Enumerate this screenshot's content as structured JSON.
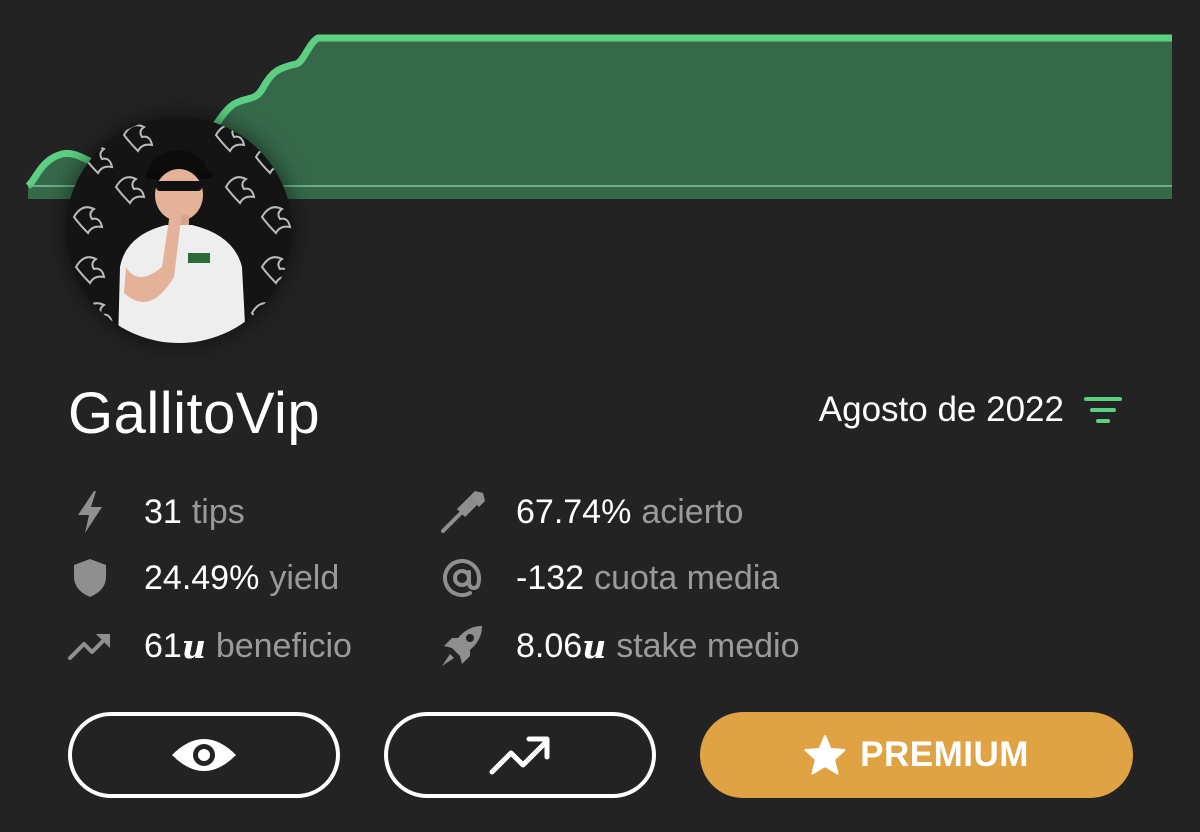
{
  "profile": {
    "username": "GallitoVip",
    "avatar": "avatar-photo"
  },
  "period": {
    "label": "Agosto de 2022",
    "icon": "filter-icon"
  },
  "stats": [
    {
      "icon": "bolt-icon",
      "value": "31",
      "unit": "",
      "label": "tips"
    },
    {
      "icon": "dart-icon",
      "value": "67.74%",
      "unit": "",
      "label": "acierto"
    },
    {
      "icon": "shield-icon",
      "value": "24.49%",
      "unit": "",
      "label": "yield"
    },
    {
      "icon": "at-icon",
      "value": "-132",
      "unit": "",
      "label": "cuota media"
    },
    {
      "icon": "trending-up-icon",
      "value": "61",
      "unit": "u",
      "label": "beneficio"
    },
    {
      "icon": "rocket-icon",
      "value": "8.06",
      "unit": "u",
      "label": "stake medio"
    }
  ],
  "actions": {
    "view_icon": "eye-icon",
    "chart_icon": "trending-up-icon",
    "premium_label": "PREMIUM",
    "premium_icon": "star-icon"
  },
  "colors": {
    "background": "#232323",
    "accent_green": "#5ccf82",
    "chart_fill": "#36694a",
    "premium": "#e0a344",
    "muted_text": "#9a9a9a"
  }
}
